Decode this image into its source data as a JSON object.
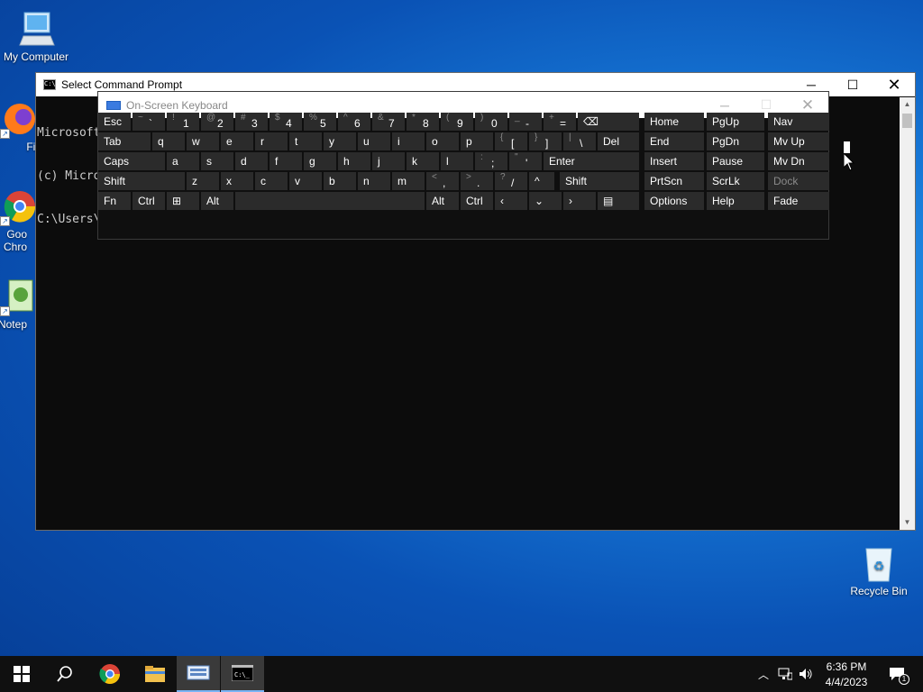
{
  "desktop": {
    "icons": [
      {
        "label": "My Computer"
      },
      {
        "label": "Fire"
      },
      {
        "label": "Goo Chro"
      },
      {
        "label": "Notep"
      },
      {
        "label": "Recycle Bin"
      }
    ]
  },
  "cmd": {
    "title": "Select Command Prompt",
    "lines": [
      "Microsoft",
      "(c) Micro",
      "C:\\Users\\"
    ]
  },
  "osk": {
    "title": "On-Screen Keyboard",
    "rows": [
      [
        {
          "label": "Esc"
        },
        {
          "sub": "~",
          "main": "`"
        },
        {
          "sub": "!",
          "main": "1"
        },
        {
          "sub": "@",
          "main": "2"
        },
        {
          "sub": "#",
          "main": "3"
        },
        {
          "sub": "$",
          "main": "4"
        },
        {
          "sub": "%",
          "main": "5"
        },
        {
          "sub": "^",
          "main": "6"
        },
        {
          "sub": "&",
          "main": "7"
        },
        {
          "sub": "*",
          "main": "8"
        },
        {
          "sub": "(",
          "main": "9"
        },
        {
          "sub": ")",
          "main": "0"
        },
        {
          "sub": "_",
          "main": "-"
        },
        {
          "sub": "+",
          "main": "="
        },
        {
          "label": "⌫"
        },
        {
          "label": "Home"
        },
        {
          "label": "PgUp"
        },
        {
          "label": "Nav"
        }
      ],
      [
        {
          "label": "Tab"
        },
        {
          "label": "q"
        },
        {
          "label": "w"
        },
        {
          "label": "e"
        },
        {
          "label": "r"
        },
        {
          "label": "t"
        },
        {
          "label": "y"
        },
        {
          "label": "u"
        },
        {
          "label": "i"
        },
        {
          "label": "o"
        },
        {
          "label": "p"
        },
        {
          "sub": "{",
          "main": "["
        },
        {
          "sub": "}",
          "main": "]"
        },
        {
          "sub": "|",
          "main": "\\"
        },
        {
          "label": "Del"
        },
        {
          "label": "End"
        },
        {
          "label": "PgDn"
        },
        {
          "label": "Mv Up"
        }
      ],
      [
        {
          "label": "Caps"
        },
        {
          "label": "a"
        },
        {
          "label": "s"
        },
        {
          "label": "d"
        },
        {
          "label": "f"
        },
        {
          "label": "g"
        },
        {
          "label": "h"
        },
        {
          "label": "j"
        },
        {
          "label": "k"
        },
        {
          "label": "l"
        },
        {
          "sub": ":",
          "main": ";"
        },
        {
          "sub": "\"",
          "main": "'"
        },
        {
          "label": "Enter"
        },
        {
          "label": "Insert"
        },
        {
          "label": "Pause"
        },
        {
          "label": "Mv Dn"
        }
      ],
      [
        {
          "label": "Shift"
        },
        {
          "label": "z"
        },
        {
          "label": "x"
        },
        {
          "label": "c"
        },
        {
          "label": "v"
        },
        {
          "label": "b"
        },
        {
          "label": "n"
        },
        {
          "label": "m"
        },
        {
          "sub": "<",
          "main": ","
        },
        {
          "sub": ">",
          "main": "."
        },
        {
          "sub": "?",
          "main": "/"
        },
        {
          "label": "^"
        },
        {
          "label": "Shift"
        },
        {
          "label": "PrtScn"
        },
        {
          "label": "ScrLk"
        },
        {
          "label": "Dock"
        }
      ],
      [
        {
          "label": "Fn"
        },
        {
          "label": "Ctrl"
        },
        {
          "label": "⊞"
        },
        {
          "label": "Alt"
        },
        {
          "label": ""
        },
        {
          "label": "Alt"
        },
        {
          "label": "Ctrl"
        },
        {
          "label": "‹"
        },
        {
          "label": "⌄"
        },
        {
          "label": "›"
        },
        {
          "label": "▤"
        },
        {
          "label": "Options"
        },
        {
          "label": "Help"
        },
        {
          "label": "Fade"
        }
      ]
    ]
  },
  "taskbar": {
    "time": "6:36 PM",
    "date": "4/4/2023",
    "notification_count": "1"
  }
}
